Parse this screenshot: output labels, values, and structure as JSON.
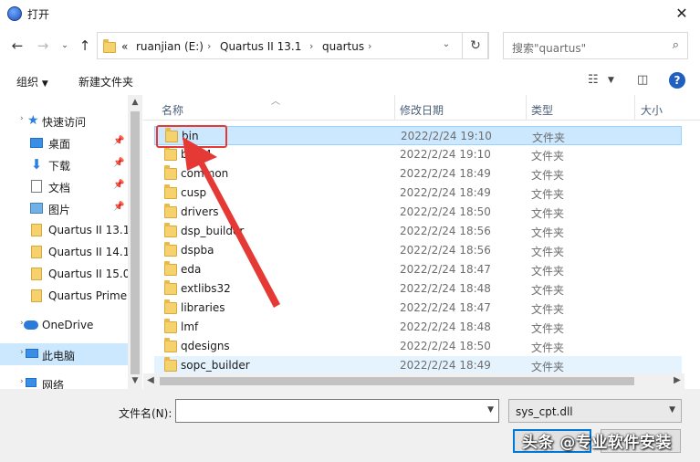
{
  "window": {
    "title": "打开"
  },
  "address": {
    "overflow": "«",
    "crumbs": [
      "ruanjian (E:)",
      "Quartus II 13.1",
      "quartus"
    ]
  },
  "search": {
    "placeholder": "搜索\"quartus\""
  },
  "toolbar": {
    "organize": "组织",
    "new_folder": "新建文件夹"
  },
  "sidebar": {
    "items": [
      {
        "label": "快速访问",
        "icon": "star-icon",
        "pinned": false
      },
      {
        "label": "桌面",
        "icon": "desktop-icon",
        "pinned": true
      },
      {
        "label": "下载",
        "icon": "download-icon",
        "pinned": true
      },
      {
        "label": "文档",
        "icon": "document-icon",
        "pinned": true
      },
      {
        "label": "图片",
        "icon": "picture-icon",
        "pinned": true
      },
      {
        "label": "Quartus II 13.1",
        "icon": "folder-icon",
        "pinned": false
      },
      {
        "label": "Quartus II 14.1",
        "icon": "folder-icon",
        "pinned": false
      },
      {
        "label": "Quartus II 15.0",
        "icon": "folder-icon",
        "pinned": false
      },
      {
        "label": "Quartus Prime",
        "icon": "folder-icon",
        "pinned": false
      },
      {
        "label": "OneDrive",
        "icon": "cloud-icon",
        "pinned": false
      },
      {
        "label": "此电脑",
        "icon": "computer-icon",
        "pinned": false
      },
      {
        "label": "网络",
        "icon": "network-icon",
        "pinned": false
      }
    ]
  },
  "columns": {
    "name": "名称",
    "modified": "修改日期",
    "type": "类型",
    "size": "大小"
  },
  "files": [
    {
      "name": "bin",
      "modified": "2022/2/24 19:10",
      "type": "文件夹"
    },
    {
      "name": "bin64",
      "modified": "2022/2/24 19:10",
      "type": "文件夹"
    },
    {
      "name": "common",
      "modified": "2022/2/24 18:49",
      "type": "文件夹"
    },
    {
      "name": "cusp",
      "modified": "2022/2/24 18:49",
      "type": "文件夹"
    },
    {
      "name": "drivers",
      "modified": "2022/2/24 18:50",
      "type": "文件夹"
    },
    {
      "name": "dsp_builder",
      "modified": "2022/2/24 18:56",
      "type": "文件夹"
    },
    {
      "name": "dspba",
      "modified": "2022/2/24 18:56",
      "type": "文件夹"
    },
    {
      "name": "eda",
      "modified": "2022/2/24 18:47",
      "type": "文件夹"
    },
    {
      "name": "extlibs32",
      "modified": "2022/2/24 18:48",
      "type": "文件夹"
    },
    {
      "name": "libraries",
      "modified": "2022/2/24 18:47",
      "type": "文件夹"
    },
    {
      "name": "lmf",
      "modified": "2022/2/24 18:48",
      "type": "文件夹"
    },
    {
      "name": "qdesigns",
      "modified": "2022/2/24 18:50",
      "type": "文件夹"
    },
    {
      "name": "sopc_builder",
      "modified": "2022/2/24 18:49",
      "type": "文件夹"
    }
  ],
  "footer": {
    "filename_label": "文件名(N):",
    "filename_value": "",
    "filter": "sys_cpt.dll"
  },
  "watermark": "头条 @专业软件安装",
  "colors": {
    "selection": "#cce8ff",
    "annotation": "#e53935",
    "accent": "#0078d7"
  }
}
